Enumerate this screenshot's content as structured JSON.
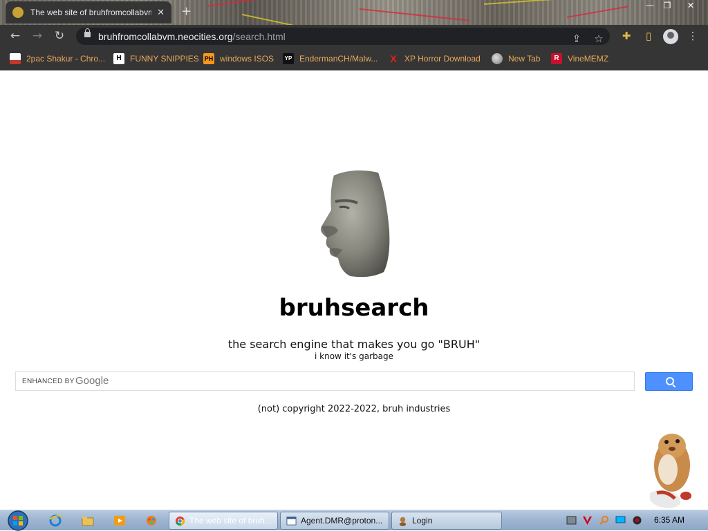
{
  "browser": {
    "tab_title": "The web site of bruhfromcollabvm",
    "tab_close": "✕",
    "new_tab": "+",
    "url_host": "bruhfromcollabvm.neocities.org",
    "url_path": "/search.html",
    "window_controls": {
      "minimize": "—",
      "maximize": "❐",
      "close": "✕"
    },
    "nav": {
      "back": "←",
      "forward": "→",
      "reload": "↻"
    },
    "toolbar_icons": {
      "share": "⇪",
      "star": "☆",
      "extensions": "✚",
      "sidebar": "▯",
      "menu": "⋮"
    },
    "bookmarks": [
      {
        "label": "2pac Shakur - Chro...",
        "icon": "bag-icon",
        "icon_text": "",
        "icon_color": "#c0392b"
      },
      {
        "label": "FUNNY SNIPPIES",
        "icon": "h-icon",
        "icon_text": "H",
        "icon_color": "#ffffff"
      },
      {
        "label": "windows ISOS",
        "icon": "ph-icon",
        "icon_text": "PH",
        "icon_color": "#f7971d"
      },
      {
        "label": "EndermanCH/Malw...",
        "icon": "yp-icon",
        "icon_text": "YP",
        "icon_color": "#222222"
      },
      {
        "label": "XP Horror Download",
        "icon": "x-icon",
        "icon_text": "X",
        "icon_color": "#e02020"
      },
      {
        "label": "New Tab",
        "icon": "globe-icon",
        "icon_text": "",
        "icon_color": "#888888"
      },
      {
        "label": "VineMEMZ",
        "icon": "r-icon",
        "icon_text": "R",
        "icon_color": "#c8102e"
      }
    ]
  },
  "page": {
    "title": "bruhsearch",
    "tagline": "the search engine that makes you go \"BRUH\"",
    "subtagline": "i know it's garbage",
    "search": {
      "enhanced_by": "ENHANCED BY",
      "brand": "Google"
    },
    "copyright": "(not) copyright 2022-2022, bruh industries"
  },
  "taskbar": {
    "windows": [
      {
        "label": "The web site of bruh...",
        "icon": "chrome-icon",
        "active": true
      },
      {
        "label": "Agent.DMR@proton...",
        "icon": "window-icon",
        "active": false
      },
      {
        "label": "Login",
        "icon": "login-icon",
        "active": false
      }
    ],
    "clock": "6:35 AM"
  },
  "colors": {
    "bookmark_text": "#e8a85c",
    "chrome_dark": "#353535",
    "search_button": "#4d90fe"
  }
}
